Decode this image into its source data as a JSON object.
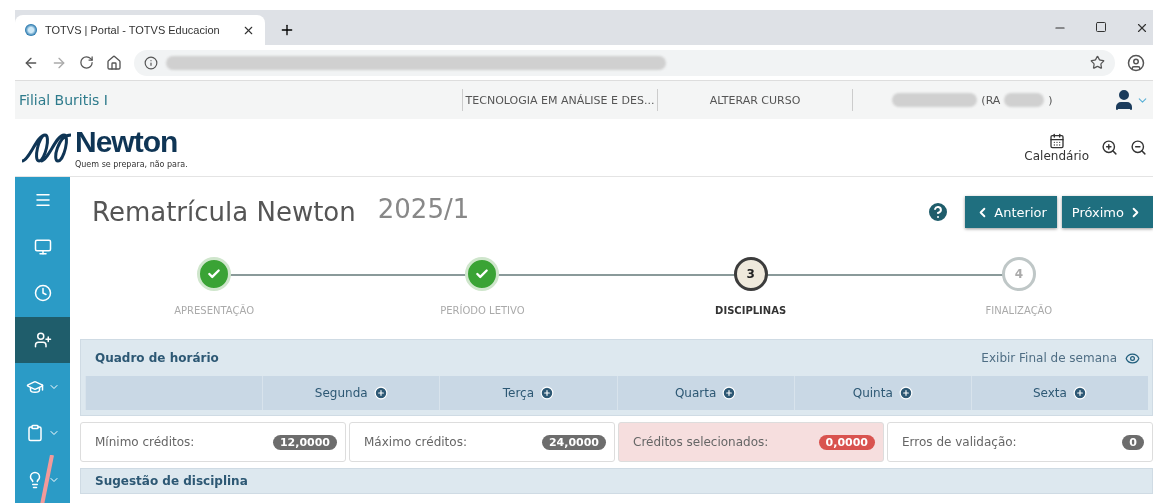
{
  "browser": {
    "tab_title": "TOTVS | Portal - TOTVS Educacion"
  },
  "topbar": {
    "branch": "Filial Buritis I",
    "course": "TECNOLOGIA EM ANÁLISE E DES...",
    "change_course": "ALTERAR CURSO",
    "ra_open": "(RA",
    "ra_close": ")"
  },
  "logo": {
    "name": "Newton",
    "tagline": "Quem se prepara, não para."
  },
  "tools": {
    "calendar": "Calendário"
  },
  "sidebar": {
    "items": [
      {
        "kind": "menu",
        "selected": false,
        "expandable": false
      },
      {
        "kind": "monitor",
        "selected": false,
        "expandable": false
      },
      {
        "kind": "clock",
        "selected": false,
        "expandable": false
      },
      {
        "kind": "user-plus",
        "selected": true,
        "expandable": false
      },
      {
        "kind": "graduation",
        "selected": false,
        "expandable": true
      },
      {
        "kind": "clipboard",
        "selected": false,
        "expandable": true
      },
      {
        "kind": "bulb",
        "selected": false,
        "expandable": true
      }
    ]
  },
  "page": {
    "title": "Rematrícula Newton",
    "period": "2025/1",
    "buttons": [
      {
        "kind": "prev",
        "label": "Anterior"
      },
      {
        "kind": "next",
        "label": "Próximo"
      }
    ]
  },
  "steps": [
    {
      "label": "APRESENTAÇÃO",
      "completed": true,
      "active": false
    },
    {
      "label": "PERÍODO LETIVO",
      "completed": true,
      "active": false
    },
    {
      "label": "DISCIPLINAS",
      "number": "3",
      "completed": false,
      "active": true
    },
    {
      "label": "FINALIZAÇÃO",
      "number": "4",
      "completed": false,
      "active": false
    }
  ],
  "schedule": {
    "title": "Quadro de horário",
    "weekend_toggle": "Exibir Final de semana",
    "days": [
      "Segunda",
      "Terça",
      "Quarta",
      "Quinta",
      "Sexta"
    ]
  },
  "credits": [
    {
      "label": "Mínimo créditos:",
      "value": "12,0000",
      "alert": false
    },
    {
      "label": "Máximo créditos:",
      "value": "24,0000",
      "alert": false
    },
    {
      "label": "Créditos selecionados:",
      "value": "0,0000",
      "alert": true
    },
    {
      "label": "Erros de validação:",
      "value": "0",
      "alert": false
    }
  ],
  "suggestion": {
    "title": "Sugestão de disciplina"
  }
}
